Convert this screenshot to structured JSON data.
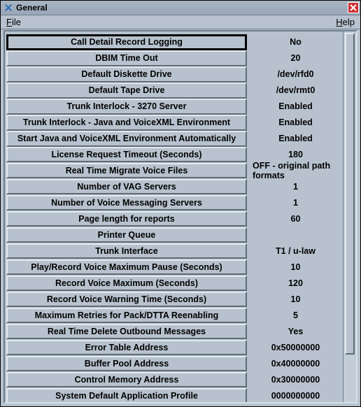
{
  "window": {
    "title": "General"
  },
  "menu": {
    "file": "File",
    "help": "Help"
  },
  "rows": [
    {
      "label": "Call Detail Record Logging",
      "value": "No",
      "selected": true
    },
    {
      "label": "DBIM Time Out",
      "value": "20"
    },
    {
      "label": "Default Diskette Drive",
      "value": "/dev/rfd0"
    },
    {
      "label": "Default Tape Drive",
      "value": "/dev/rmt0"
    },
    {
      "label": "Trunk Interlock - 3270 Server",
      "value": "Enabled"
    },
    {
      "label": "Trunk Interlock - Java and VoiceXML Environment",
      "value": "Enabled"
    },
    {
      "label": "Start Java and VoiceXML Environment Automatically",
      "value": "Enabled"
    },
    {
      "label": "License Request Timeout (Seconds)",
      "value": "180"
    },
    {
      "label": "Real Time Migrate Voice Files",
      "value": "OFF - original path formats"
    },
    {
      "label": "Number of VAG Servers",
      "value": "1"
    },
    {
      "label": "Number of Voice Messaging Servers",
      "value": "1"
    },
    {
      "label": "Page length for reports",
      "value": "60"
    },
    {
      "label": "Printer Queue",
      "value": ""
    },
    {
      "label": "Trunk Interface",
      "value": "T1 / u-law"
    },
    {
      "label": "Play/Record Voice Maximum Pause (Seconds)",
      "value": "10"
    },
    {
      "label": "Record Voice Maximum (Seconds)",
      "value": "120"
    },
    {
      "label": "Record Voice Warning Time (Seconds)",
      "value": "10"
    },
    {
      "label": "Maximum Retries for Pack/DTTA Reenabling",
      "value": "5"
    },
    {
      "label": "Real Time Delete Outbound Messages",
      "value": "Yes"
    },
    {
      "label": "Error Table Address",
      "value": "0x50000000"
    },
    {
      "label": "Buffer Pool Address",
      "value": "0x40000000"
    },
    {
      "label": "Control Memory Address",
      "value": "0x30000000"
    },
    {
      "label": "System Default Application Profile",
      "value": "0000000000"
    }
  ]
}
